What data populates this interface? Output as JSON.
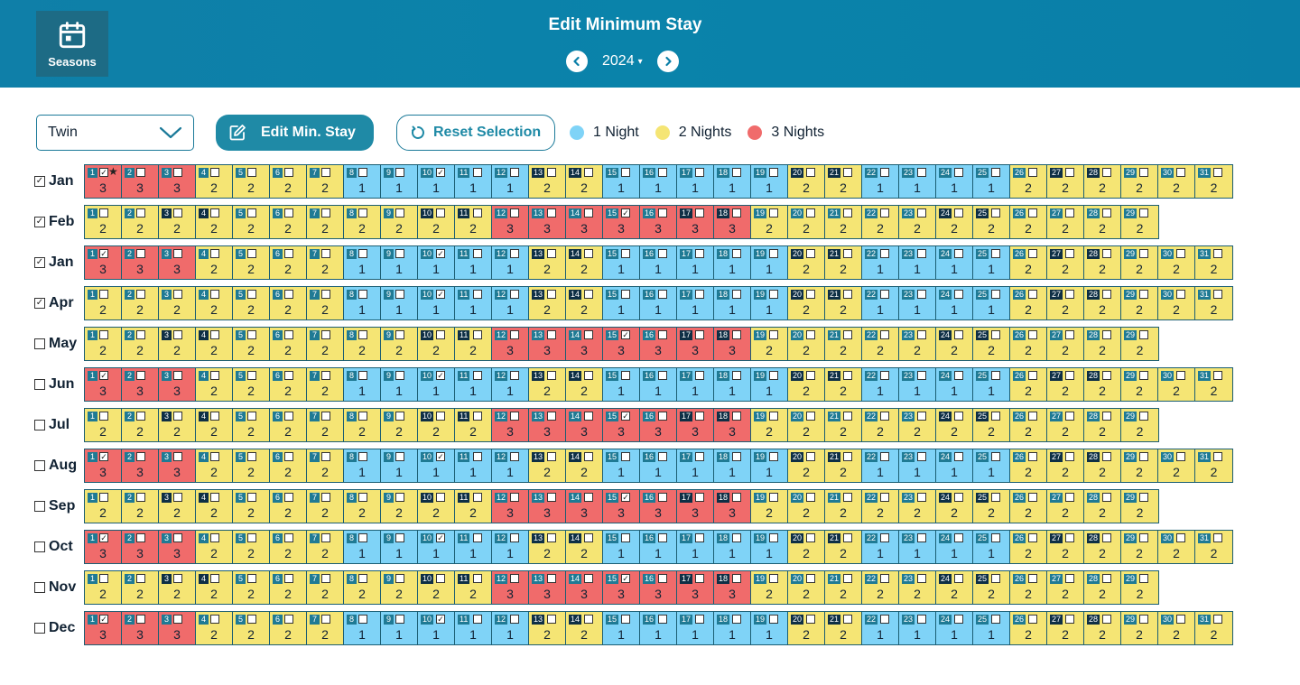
{
  "header": {
    "title": "Edit Minimum Stay",
    "seasons_label": "Seasons",
    "year": "2024"
  },
  "toolbar": {
    "room_type": "Twin",
    "edit_label": "Edit Min. Stay",
    "reset_label": "Reset Selection"
  },
  "legend": [
    {
      "label": "1 Night",
      "color": "#7fd3f7"
    },
    {
      "label": "2 Nights",
      "color": "#f5e574"
    },
    {
      "label": "3 Nights",
      "color": "#f06b6b"
    }
  ],
  "colors": {
    "1": "#7fd3f7",
    "2": "#f5e574",
    "3": "#f06b6b"
  },
  "patterns": {
    "A": {
      "values": [
        3,
        3,
        3,
        2,
        2,
        2,
        2,
        1,
        1,
        1,
        1,
        1,
        2,
        2,
        1,
        1,
        1,
        1,
        1,
        2,
        2,
        1,
        1,
        1,
        1,
        2,
        2,
        2,
        2,
        2,
        2
      ],
      "dark": [
        20,
        21,
        27,
        28
      ],
      "checked": [
        1,
        10
      ]
    },
    "B": {
      "values": [
        2,
        2,
        2,
        2,
        2,
        2,
        2,
        1,
        1,
        1,
        1,
        1,
        2,
        2,
        1,
        1,
        1,
        1,
        1,
        2,
        2,
        1,
        1,
        1,
        1,
        2,
        2,
        2,
        2,
        2,
        2
      ],
      "dark": [
        13,
        14,
        20,
        21,
        27,
        28
      ],
      "checked": [
        10
      ]
    },
    "C": {
      "values": [
        2,
        2,
        2,
        2,
        2,
        2,
        2,
        2,
        2,
        2,
        2,
        3,
        3,
        3,
        3,
        3,
        3,
        3,
        2,
        2,
        2,
        2,
        2,
        2,
        2,
        2,
        2,
        2,
        2
      ],
      "dark": [
        3,
        4,
        10,
        11,
        17,
        18,
        24,
        25
      ],
      "checked": [
        15
      ]
    }
  },
  "months": [
    {
      "name": "Jan",
      "checked": true,
      "pattern": "A",
      "dark_extra": [
        13,
        14
      ],
      "star": 1
    },
    {
      "name": "Feb",
      "checked": true,
      "pattern": "C"
    },
    {
      "name": "Jan",
      "checked": true,
      "pattern": "A",
      "dark_extra": [
        13,
        14
      ]
    },
    {
      "name": "Apr",
      "checked": true,
      "pattern": "B"
    },
    {
      "name": "May",
      "checked": false,
      "pattern": "C"
    },
    {
      "name": "Jun",
      "checked": false,
      "pattern": "A",
      "dark_extra": [
        13,
        14
      ]
    },
    {
      "name": "Jul",
      "checked": false,
      "pattern": "C"
    },
    {
      "name": "Aug",
      "checked": false,
      "pattern": "A",
      "dark_extra": [
        13,
        14
      ]
    },
    {
      "name": "Sep",
      "checked": false,
      "pattern": "C"
    },
    {
      "name": "Oct",
      "checked": false,
      "pattern": "A",
      "dark_extra": [
        13,
        14
      ]
    },
    {
      "name": "Nov",
      "checked": false,
      "pattern": "C"
    },
    {
      "name": "Dec",
      "checked": false,
      "pattern": "A",
      "dark_extra": [
        13,
        14
      ]
    }
  ]
}
